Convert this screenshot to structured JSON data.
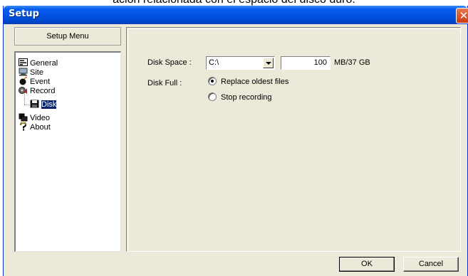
{
  "top_caption": "ación relacionada con el espacio del disco duro.",
  "window": {
    "title": "Setup",
    "close_glyph": "✕"
  },
  "menu": {
    "header": "Setup Menu",
    "items": [
      {
        "label": "General",
        "icon": "general-icon"
      },
      {
        "label": "Site",
        "icon": "site-icon"
      },
      {
        "label": "Event",
        "icon": "event-icon"
      },
      {
        "label": "Record",
        "icon": "record-icon"
      },
      {
        "label": "Disk",
        "icon": "disk-icon",
        "selected": true
      },
      {
        "label": "Video",
        "icon": "video-icon"
      },
      {
        "label": "About",
        "icon": "about-icon"
      }
    ]
  },
  "disk": {
    "space_label": "Disk Space :",
    "drive_value": "C:\\",
    "size_value": "100",
    "size_unit": "MB/37 GB",
    "full_label": "Disk Full :",
    "options": [
      {
        "label": "Replace oldest files",
        "checked": true
      },
      {
        "label": "Stop recording",
        "checked": false
      }
    ]
  },
  "buttons": {
    "ok": "OK",
    "cancel": "Cancel"
  }
}
